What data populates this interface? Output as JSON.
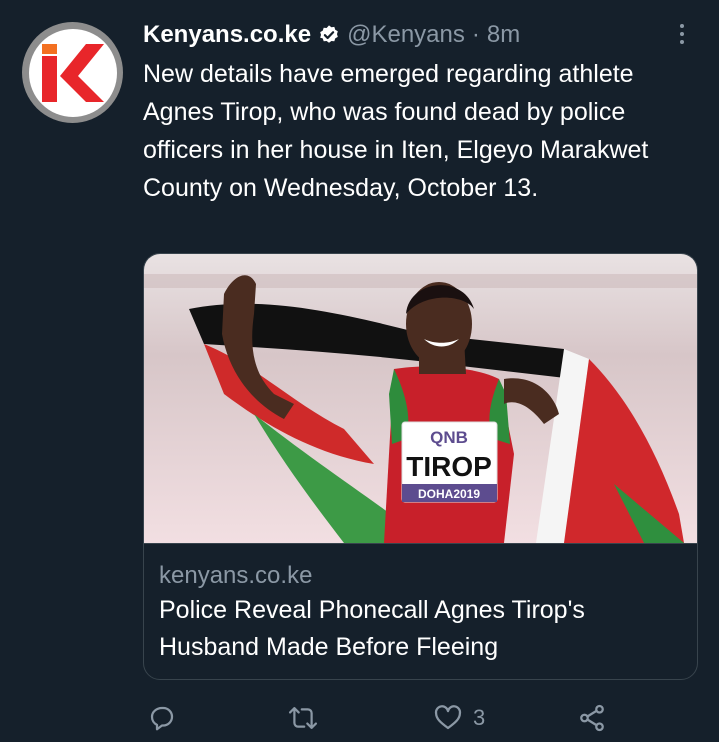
{
  "tweet": {
    "author_name": "Kenyans.co.ke",
    "handle": "@Kenyans",
    "separator": "·",
    "time": "8m",
    "text": "New details have emerged regarding athlete Agnes Tirop, who was found dead by police officers in her house in Iten, Elgeyo Marakwet County on Wednesday, October 13."
  },
  "card": {
    "domain": "kenyans.co.ke",
    "title": "Police Reveal Phonecall Agnes Tirop's Husband Made Before Fleeing",
    "image": {
      "bib_sponsor": "QNB",
      "bib_name": "TIROP",
      "bib_event": "DOHA2019"
    }
  },
  "actions": {
    "reply_icon": "reply-icon",
    "retweet_icon": "retweet-icon",
    "like_icon": "heart-icon",
    "like_count": "3",
    "share_icon": "share-icon"
  },
  "colors": {
    "background": "#15202b",
    "text": "#ffffff",
    "muted": "#8b98a5",
    "border": "#38444d",
    "logo_red": "#e8262a",
    "logo_orange": "#f37021"
  }
}
